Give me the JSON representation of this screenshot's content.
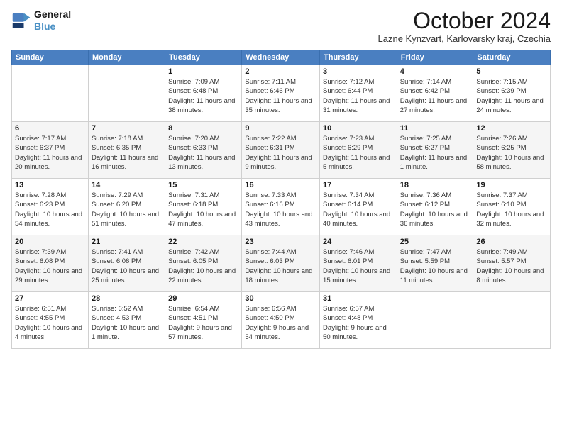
{
  "logo": {
    "line1": "General",
    "line2": "Blue"
  },
  "header": {
    "month_title": "October 2024",
    "subtitle": "Lazne Kynzvart, Karlovarsky kraj, Czechia"
  },
  "weekdays": [
    "Sunday",
    "Monday",
    "Tuesday",
    "Wednesday",
    "Thursday",
    "Friday",
    "Saturday"
  ],
  "weeks": [
    [
      {
        "day": "",
        "info": ""
      },
      {
        "day": "",
        "info": ""
      },
      {
        "day": "1",
        "info": "Sunrise: 7:09 AM\nSunset: 6:48 PM\nDaylight: 11 hours and 38 minutes."
      },
      {
        "day": "2",
        "info": "Sunrise: 7:11 AM\nSunset: 6:46 PM\nDaylight: 11 hours and 35 minutes."
      },
      {
        "day": "3",
        "info": "Sunrise: 7:12 AM\nSunset: 6:44 PM\nDaylight: 11 hours and 31 minutes."
      },
      {
        "day": "4",
        "info": "Sunrise: 7:14 AM\nSunset: 6:42 PM\nDaylight: 11 hours and 27 minutes."
      },
      {
        "day": "5",
        "info": "Sunrise: 7:15 AM\nSunset: 6:39 PM\nDaylight: 11 hours and 24 minutes."
      }
    ],
    [
      {
        "day": "6",
        "info": "Sunrise: 7:17 AM\nSunset: 6:37 PM\nDaylight: 11 hours and 20 minutes."
      },
      {
        "day": "7",
        "info": "Sunrise: 7:18 AM\nSunset: 6:35 PM\nDaylight: 11 hours and 16 minutes."
      },
      {
        "day": "8",
        "info": "Sunrise: 7:20 AM\nSunset: 6:33 PM\nDaylight: 11 hours and 13 minutes."
      },
      {
        "day": "9",
        "info": "Sunrise: 7:22 AM\nSunset: 6:31 PM\nDaylight: 11 hours and 9 minutes."
      },
      {
        "day": "10",
        "info": "Sunrise: 7:23 AM\nSunset: 6:29 PM\nDaylight: 11 hours and 5 minutes."
      },
      {
        "day": "11",
        "info": "Sunrise: 7:25 AM\nSunset: 6:27 PM\nDaylight: 11 hours and 1 minute."
      },
      {
        "day": "12",
        "info": "Sunrise: 7:26 AM\nSunset: 6:25 PM\nDaylight: 10 hours and 58 minutes."
      }
    ],
    [
      {
        "day": "13",
        "info": "Sunrise: 7:28 AM\nSunset: 6:23 PM\nDaylight: 10 hours and 54 minutes."
      },
      {
        "day": "14",
        "info": "Sunrise: 7:29 AM\nSunset: 6:20 PM\nDaylight: 10 hours and 51 minutes."
      },
      {
        "day": "15",
        "info": "Sunrise: 7:31 AM\nSunset: 6:18 PM\nDaylight: 10 hours and 47 minutes."
      },
      {
        "day": "16",
        "info": "Sunrise: 7:33 AM\nSunset: 6:16 PM\nDaylight: 10 hours and 43 minutes."
      },
      {
        "day": "17",
        "info": "Sunrise: 7:34 AM\nSunset: 6:14 PM\nDaylight: 10 hours and 40 minutes."
      },
      {
        "day": "18",
        "info": "Sunrise: 7:36 AM\nSunset: 6:12 PM\nDaylight: 10 hours and 36 minutes."
      },
      {
        "day": "19",
        "info": "Sunrise: 7:37 AM\nSunset: 6:10 PM\nDaylight: 10 hours and 32 minutes."
      }
    ],
    [
      {
        "day": "20",
        "info": "Sunrise: 7:39 AM\nSunset: 6:08 PM\nDaylight: 10 hours and 29 minutes."
      },
      {
        "day": "21",
        "info": "Sunrise: 7:41 AM\nSunset: 6:06 PM\nDaylight: 10 hours and 25 minutes."
      },
      {
        "day": "22",
        "info": "Sunrise: 7:42 AM\nSunset: 6:05 PM\nDaylight: 10 hours and 22 minutes."
      },
      {
        "day": "23",
        "info": "Sunrise: 7:44 AM\nSunset: 6:03 PM\nDaylight: 10 hours and 18 minutes."
      },
      {
        "day": "24",
        "info": "Sunrise: 7:46 AM\nSunset: 6:01 PM\nDaylight: 10 hours and 15 minutes."
      },
      {
        "day": "25",
        "info": "Sunrise: 7:47 AM\nSunset: 5:59 PM\nDaylight: 10 hours and 11 minutes."
      },
      {
        "day": "26",
        "info": "Sunrise: 7:49 AM\nSunset: 5:57 PM\nDaylight: 10 hours and 8 minutes."
      }
    ],
    [
      {
        "day": "27",
        "info": "Sunrise: 6:51 AM\nSunset: 4:55 PM\nDaylight: 10 hours and 4 minutes."
      },
      {
        "day": "28",
        "info": "Sunrise: 6:52 AM\nSunset: 4:53 PM\nDaylight: 10 hours and 1 minute."
      },
      {
        "day": "29",
        "info": "Sunrise: 6:54 AM\nSunset: 4:51 PM\nDaylight: 9 hours and 57 minutes."
      },
      {
        "day": "30",
        "info": "Sunrise: 6:56 AM\nSunset: 4:50 PM\nDaylight: 9 hours and 54 minutes."
      },
      {
        "day": "31",
        "info": "Sunrise: 6:57 AM\nSunset: 4:48 PM\nDaylight: 9 hours and 50 minutes."
      },
      {
        "day": "",
        "info": ""
      },
      {
        "day": "",
        "info": ""
      }
    ]
  ]
}
